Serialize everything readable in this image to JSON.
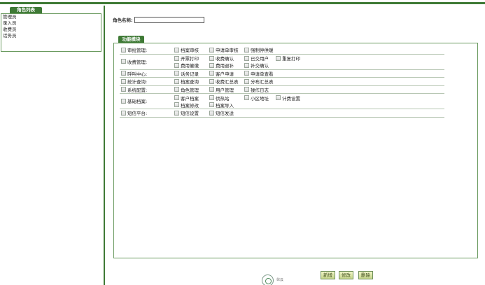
{
  "sidebar": {
    "title": "角色列表",
    "roles": [
      "管理员",
      "录入员",
      "收费员",
      "话务员"
    ]
  },
  "main": {
    "role_name_label": "角色名称:",
    "role_name_value": "",
    "module_title": "功能模块",
    "categories": [
      {
        "label": "审批管理:",
        "lines": [
          [
            "档案审核",
            "申请单审核",
            "强制停供暖"
          ]
        ]
      },
      {
        "label": "收费管理:",
        "lines": [
          [
            "开票打印",
            "收费确认",
            "已交用户",
            "重复打印"
          ],
          [
            "费用催缴",
            "费用退补",
            "补交确认"
          ]
        ]
      },
      {
        "label": "呼叫中心:",
        "lines": [
          [
            "话务记录",
            "客户申请",
            "申请单查看"
          ]
        ]
      },
      {
        "label": "统计查询:",
        "lines": [
          [
            "档案查询",
            "收费汇总表",
            "分布汇总表"
          ]
        ]
      },
      {
        "label": "系统配置:",
        "lines": [
          [
            "角色管理",
            "用户管理",
            "操作日志"
          ]
        ]
      },
      {
        "label": "基础档案:",
        "lines": [
          [
            "客户档案",
            "供热站",
            "小区地址",
            "计费设置"
          ],
          [
            "档案修改",
            "档案导入"
          ]
        ]
      },
      {
        "label": "短信平台:",
        "lines": [
          [
            "短信设置",
            "短信发送"
          ]
        ]
      }
    ]
  },
  "footer": {
    "logo_text": "伙云",
    "buttons": {
      "new": "新增",
      "edit": "修改",
      "delete": "删除"
    }
  },
  "colors": {
    "accent": "#3f7a36",
    "button_bg": "#dce6a8"
  }
}
